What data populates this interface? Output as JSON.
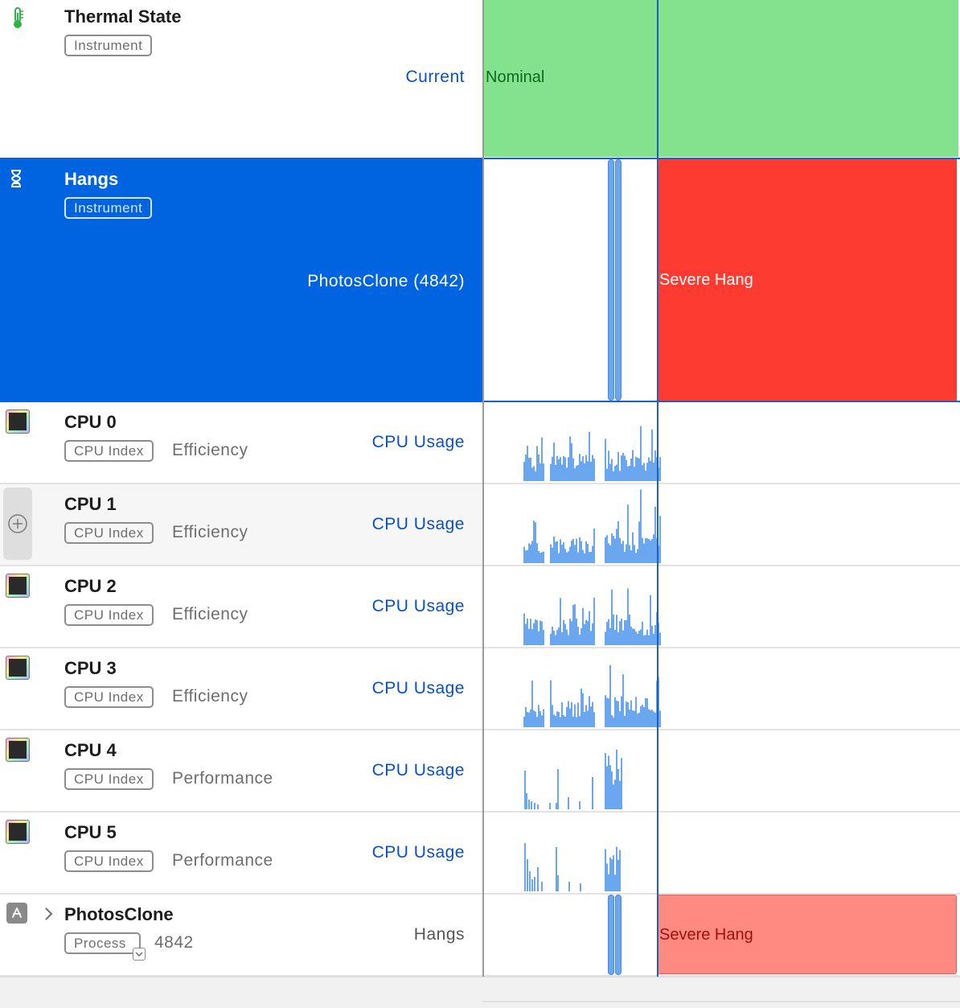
{
  "thermal": {
    "title": "Thermal State",
    "badge": "Instrument",
    "graph_label": "Current",
    "state_label": "Nominal",
    "state_color": "#82e28e",
    "icon": "thermometer-icon"
  },
  "hangs": {
    "title": "Hangs",
    "badge": "Instrument",
    "graph_label": "PhotosClone (4842)",
    "hang_label": "Severe Hang",
    "hang_color": "#fe3b30",
    "selected_color": "#0064e1",
    "icon": "hourglass-icon"
  },
  "cpus": [
    {
      "name": "CPU 0",
      "badge": "CPU Index",
      "type": "Efficiency",
      "graph_label": "CPU Usage"
    },
    {
      "name": "CPU 1",
      "badge": "CPU Index",
      "type": "Efficiency",
      "graph_label": "CPU Usage"
    },
    {
      "name": "CPU 2",
      "badge": "CPU Index",
      "type": "Efficiency",
      "graph_label": "CPU Usage"
    },
    {
      "name": "CPU 3",
      "badge": "CPU Index",
      "type": "Efficiency",
      "graph_label": "CPU Usage"
    },
    {
      "name": "CPU 4",
      "badge": "CPU Index",
      "type": "Performance",
      "graph_label": "CPU Usage"
    },
    {
      "name": "CPU 5",
      "badge": "CPU Index",
      "type": "Performance",
      "graph_label": "CPU Usage"
    }
  ],
  "process": {
    "title": "PhotosClone",
    "badge": "Process",
    "pid": "4842",
    "graph_label": "Hangs",
    "hang_label": "Severe Hang",
    "hang_color": "#ff8a82",
    "icon": "app-store-icon"
  },
  "colors": {
    "accent": "#0a51c2",
    "usage_fill": "#6aa7ef"
  }
}
